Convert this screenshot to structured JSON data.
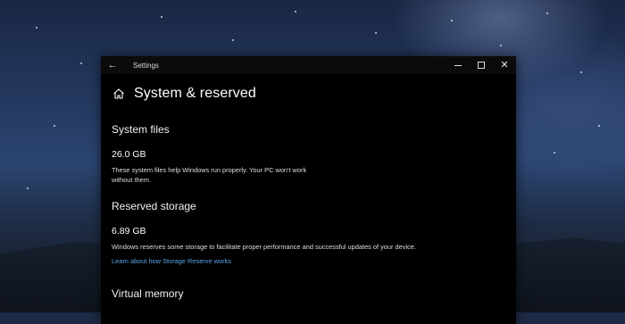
{
  "window": {
    "app_title": "Settings",
    "back_icon": "back-arrow-icon",
    "caption": {
      "minimize_icon": "minimize-icon",
      "maximize_icon": "maximize-icon",
      "close_icon": "close-icon"
    }
  },
  "page": {
    "home_icon": "home-icon",
    "title": "System & reserved"
  },
  "sections": {
    "system_files": {
      "title": "System files",
      "size": "26.0 GB",
      "description_line1": "These system files help Windows run properly. Your PC won't work",
      "description_line2": "without them."
    },
    "reserved_storage": {
      "title": "Reserved storage",
      "size": "6.89 GB",
      "description": "Windows reserves some storage to facilitate proper performance and successful updates of your device.",
      "link": "Learn about how Storage Reserve works"
    },
    "virtual_memory": {
      "title": "Virtual memory"
    }
  },
  "colors": {
    "window_bg": "#000000",
    "link": "#5aa2e8"
  }
}
